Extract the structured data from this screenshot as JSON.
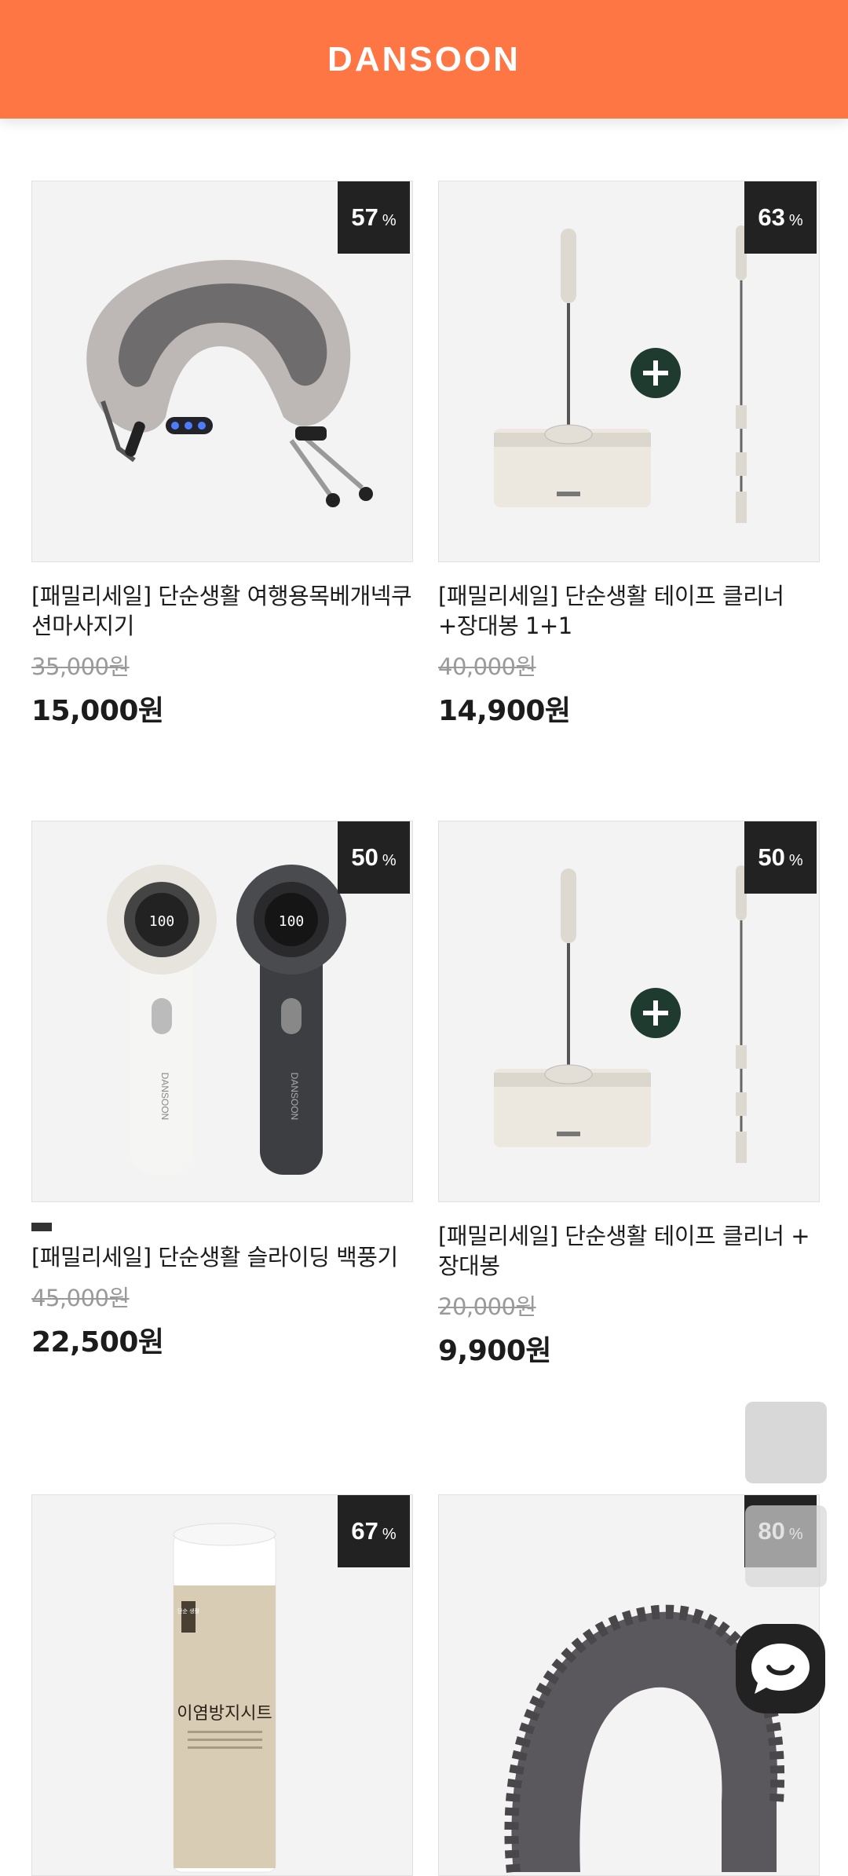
{
  "header": {
    "logo": "DANSOON"
  },
  "colors": {
    "accent": "#ff7645",
    "badge": "#222222",
    "plus": "#1f3b30"
  },
  "products": [
    {
      "discount": "57",
      "discount_unit": "%",
      "title": "[패밀리세일] 단순생활 여행용목베개넥쿠션마사지기",
      "original_price": "35,000원",
      "price": "15,000원",
      "image": "neck-pillow-massager"
    },
    {
      "discount": "63",
      "discount_unit": "%",
      "title": "[패밀리세일] 단순생활 테이프 클리너+장대봉 1+1",
      "original_price": "40,000원",
      "price": "14,900원",
      "image": "tape-cleaner-with-pole"
    },
    {
      "discount": "50",
      "discount_unit": "%",
      "title": "[패밀리세일] 단순생활 슬라이딩 백풍기",
      "original_price": "45,000원",
      "price": "22,500원",
      "image": "handheld-fans"
    },
    {
      "discount": "50",
      "discount_unit": "%",
      "title": "[패밀리세일] 단순생활 테이프 클리너 + 장대봉",
      "original_price": "20,000원",
      "price": "9,900원",
      "image": "tape-cleaner-with-pole"
    },
    {
      "discount": "67",
      "discount_unit": "%",
      "title": "",
      "original_price": "",
      "price": "",
      "image": "paper-roll",
      "roll_text": "이염방지시트",
      "roll_tag": "단순 생활"
    },
    {
      "discount": "80",
      "discount_unit": "%",
      "title": "",
      "original_price": "",
      "price": "",
      "image": "fleece-earmuff"
    }
  ],
  "fan_display": "100",
  "device_brand": "DANSOON",
  "icons": {
    "scroll_top": "scroll-up-icon",
    "scroll_bottom": "scroll-down-icon",
    "chat": "chat-bubble-icon",
    "plus": "plus-icon"
  }
}
